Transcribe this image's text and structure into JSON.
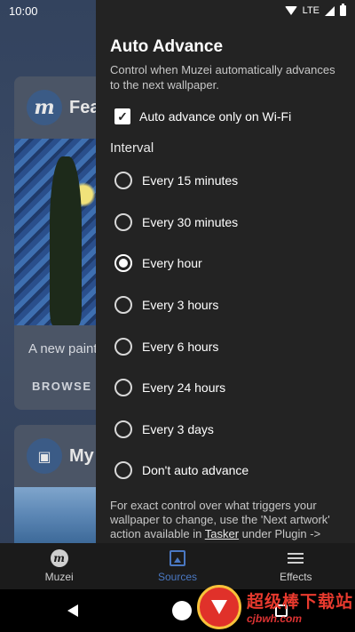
{
  "status_bar": {
    "time": "10:00",
    "network": "LTE"
  },
  "background": {
    "featured_card": {
      "avatar_letter": "m",
      "title": "Fea",
      "subtitle": "A new paint",
      "browse_label": "BROWSE"
    },
    "my_card": {
      "title": "My"
    }
  },
  "panel": {
    "title": "Auto Advance",
    "description": "Control when Muzei automatically advances to the next wallpaper.",
    "wifi_only": {
      "label": "Auto advance only on Wi-Fi",
      "checked": true
    },
    "interval_heading": "Interval",
    "intervals": [
      {
        "label": "Every 15 minutes",
        "selected": false
      },
      {
        "label": "Every 30 minutes",
        "selected": false
      },
      {
        "label": "Every hour",
        "selected": true
      },
      {
        "label": "Every 3 hours",
        "selected": false
      },
      {
        "label": "Every 6 hours",
        "selected": false
      },
      {
        "label": "Every 24 hours",
        "selected": false
      },
      {
        "label": "Every 3 days",
        "selected": false
      },
      {
        "label": "Don't auto advance",
        "selected": false
      }
    ],
    "footnote": {
      "before_link": "For exact control over what triggers your wallpaper to change, use the 'Next artwork' action available in ",
      "link": "Tasker",
      "after_link": " under Plugin -> Muzei and disable auto advance here."
    }
  },
  "bottom_nav": {
    "items": [
      {
        "label": "Muzei",
        "icon": "muzei-logo-icon",
        "active": false
      },
      {
        "label": "Sources",
        "icon": "sources-icon",
        "active": true
      },
      {
        "label": "Effects",
        "icon": "effects-sliders-icon",
        "active": false
      }
    ]
  },
  "watermark": {
    "text": "超级棒下载站",
    "url": "cjbwh.com"
  },
  "colors": {
    "panel_bg": "#232323",
    "accent": "#4a78c2",
    "nav_bg": "#1b1b1b"
  }
}
